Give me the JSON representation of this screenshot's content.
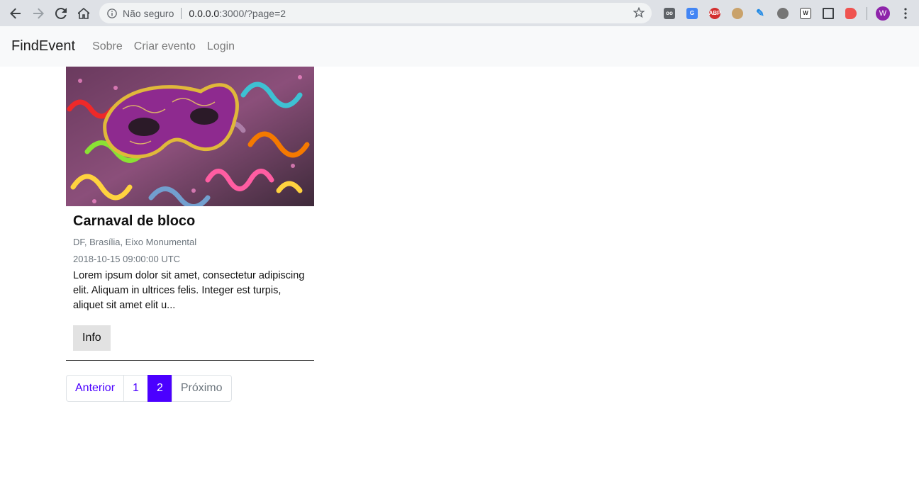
{
  "browser": {
    "security_label": "Não seguro",
    "url_host": "0.0.0.0",
    "url_rest": ":3000/?page=2",
    "extensions": [
      {
        "name": "incognito-icon",
        "color": "#5f6368",
        "text": "oo"
      },
      {
        "name": "translate-icon",
        "color": "#4285f4",
        "text": "G"
      },
      {
        "name": "adblock-icon",
        "color": "#d32f2f",
        "text": "ABP"
      },
      {
        "name": "cookie-icon",
        "color": "#c9a26b",
        "text": ""
      },
      {
        "name": "pen-icon",
        "color": "#1e88e5",
        "text": ""
      },
      {
        "name": "tomato-icon",
        "color": "#757575",
        "text": ""
      },
      {
        "name": "wikipedia-icon",
        "color": "#333333",
        "text": "W"
      },
      {
        "name": "crop-icon",
        "color": "#3c4043",
        "text": ""
      },
      {
        "name": "video-icon",
        "color": "#ef5350",
        "text": ""
      }
    ],
    "avatar_letter": "W"
  },
  "navbar": {
    "brand": "FindEvent",
    "links": [
      "Sobre",
      "Criar evento",
      "Login"
    ]
  },
  "event": {
    "title": "Carnaval de bloco",
    "location": "DF, Brasília, Eixo Monumental",
    "date": "2018-10-15 09:00:00 UTC",
    "description": "Lorem ipsum dolor sit amet, consectetur adipiscing elit. Aliquam in ultrices felis. Integer est turpis, aliquet sit amet elit u...",
    "button_label": "Info"
  },
  "pagination": {
    "prev": "Anterior",
    "pages": [
      "1",
      "2"
    ],
    "current": "2",
    "next": "Próximo"
  },
  "colors": {
    "accent": "#4b00ff",
    "navbar_bg": "#f8f9fa"
  }
}
